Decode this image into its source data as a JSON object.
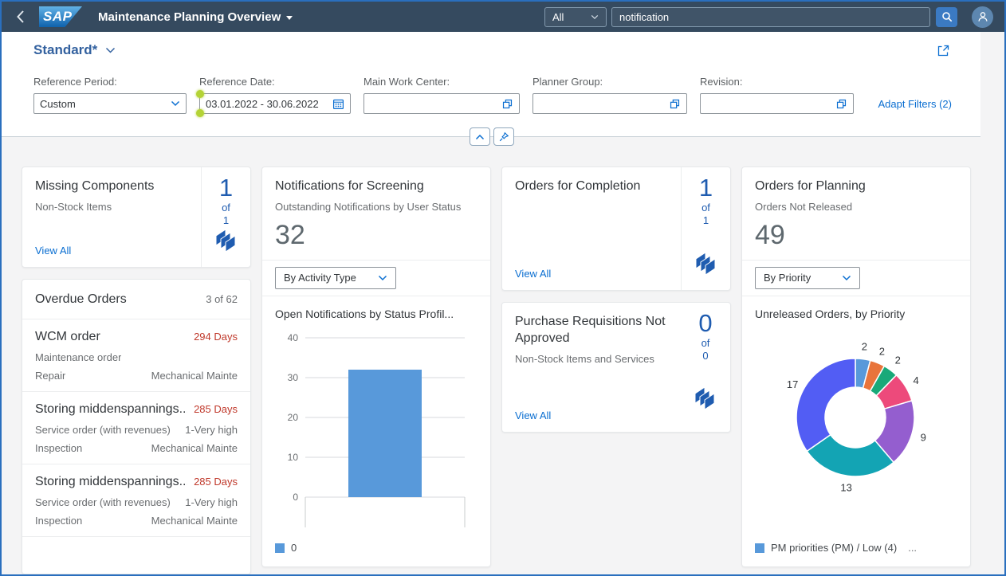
{
  "shell": {
    "logo_text": "SAP",
    "title": "Maintenance Planning Overview",
    "search_scope": "All",
    "search_value": "notification"
  },
  "ui": {
    "view_all": "View All",
    "of": "of"
  },
  "filter_bar": {
    "variant_title": "Standard*",
    "adapt_filters_label": "Adapt Filters (2)",
    "fields": [
      {
        "label": "Reference Period:",
        "value": "Custom"
      },
      {
        "label": "Reference Date:",
        "value": "03.01.2022 - 30.06.2022"
      },
      {
        "label": "Main Work Center:",
        "value": ""
      },
      {
        "label": "Planner Group:",
        "value": ""
      },
      {
        "label": "Revision:",
        "value": ""
      }
    ]
  },
  "cards": {
    "missing_components": {
      "title": "Missing Components",
      "subtitle": "Non-Stock Items",
      "count": "1",
      "total": "1"
    },
    "orders_completion": {
      "title": "Orders for Completion",
      "count": "1",
      "total": "1"
    },
    "purchase_requisitions": {
      "title": "Purchase Requisitions Not Approved",
      "subtitle": "Non-Stock Items and Services",
      "count": "0",
      "total": "0"
    },
    "overdue_orders": {
      "title": "Overdue Orders",
      "counter": "3 of 62",
      "items": [
        {
          "title": "WCM order",
          "status": "294 Days",
          "attr1_left": "Maintenance order",
          "attr1_right": "",
          "attr2_left": "Repair",
          "attr2_right": "Mechanical Mainte"
        },
        {
          "title": "Storing middenspannings...",
          "status": "285 Days",
          "attr1_left": "Service order (with revenues)",
          "attr1_right": "1-Very high",
          "attr2_left": "Inspection",
          "attr2_right": "Mechanical Mainte"
        },
        {
          "title": "Storing middenspannings...",
          "status": "285 Days",
          "attr1_left": "Service order (with revenues)",
          "attr1_right": "1-Very high",
          "attr2_left": "Inspection",
          "attr2_right": "Mechanical Mainte"
        }
      ]
    },
    "notifications_screening": {
      "title": "Notifications for Screening",
      "subtitle": "Outstanding Notifications by User Status",
      "kpi": "32",
      "dropdown_value": "By Activity Type"
    },
    "orders_planning": {
      "title": "Orders for Planning",
      "subtitle": "Orders Not Released",
      "kpi": "49",
      "dropdown_value": "By Priority"
    }
  },
  "chart_data": [
    {
      "type": "bar",
      "title": "Open Notifications by Status Profil...",
      "categories": [
        ""
      ],
      "series": [
        {
          "name": "0",
          "values": [
            32
          ]
        }
      ],
      "ylim": [
        0,
        40
      ],
      "yticks": [
        0,
        10,
        20,
        30,
        40
      ],
      "grid": true,
      "legend_position": "bottom",
      "bar_color": "#5899DA"
    },
    {
      "type": "pie",
      "donut": true,
      "title": "Unreleased Orders, by Priority",
      "values": [
        2,
        2,
        2,
        4,
        9,
        13,
        17
      ],
      "labels": [
        "2",
        "2",
        "2",
        "4",
        "9",
        "13",
        "17"
      ],
      "colors": [
        "#5899DA",
        "#E8743B",
        "#19A979",
        "#ED4A7B",
        "#945ECF",
        "#13A4B4",
        "#525DF4"
      ],
      "total": 49,
      "legend": [
        "PM priorities (PM) / Low (4)"
      ],
      "legend_more": "...",
      "legend_position": "bottom"
    }
  ]
}
